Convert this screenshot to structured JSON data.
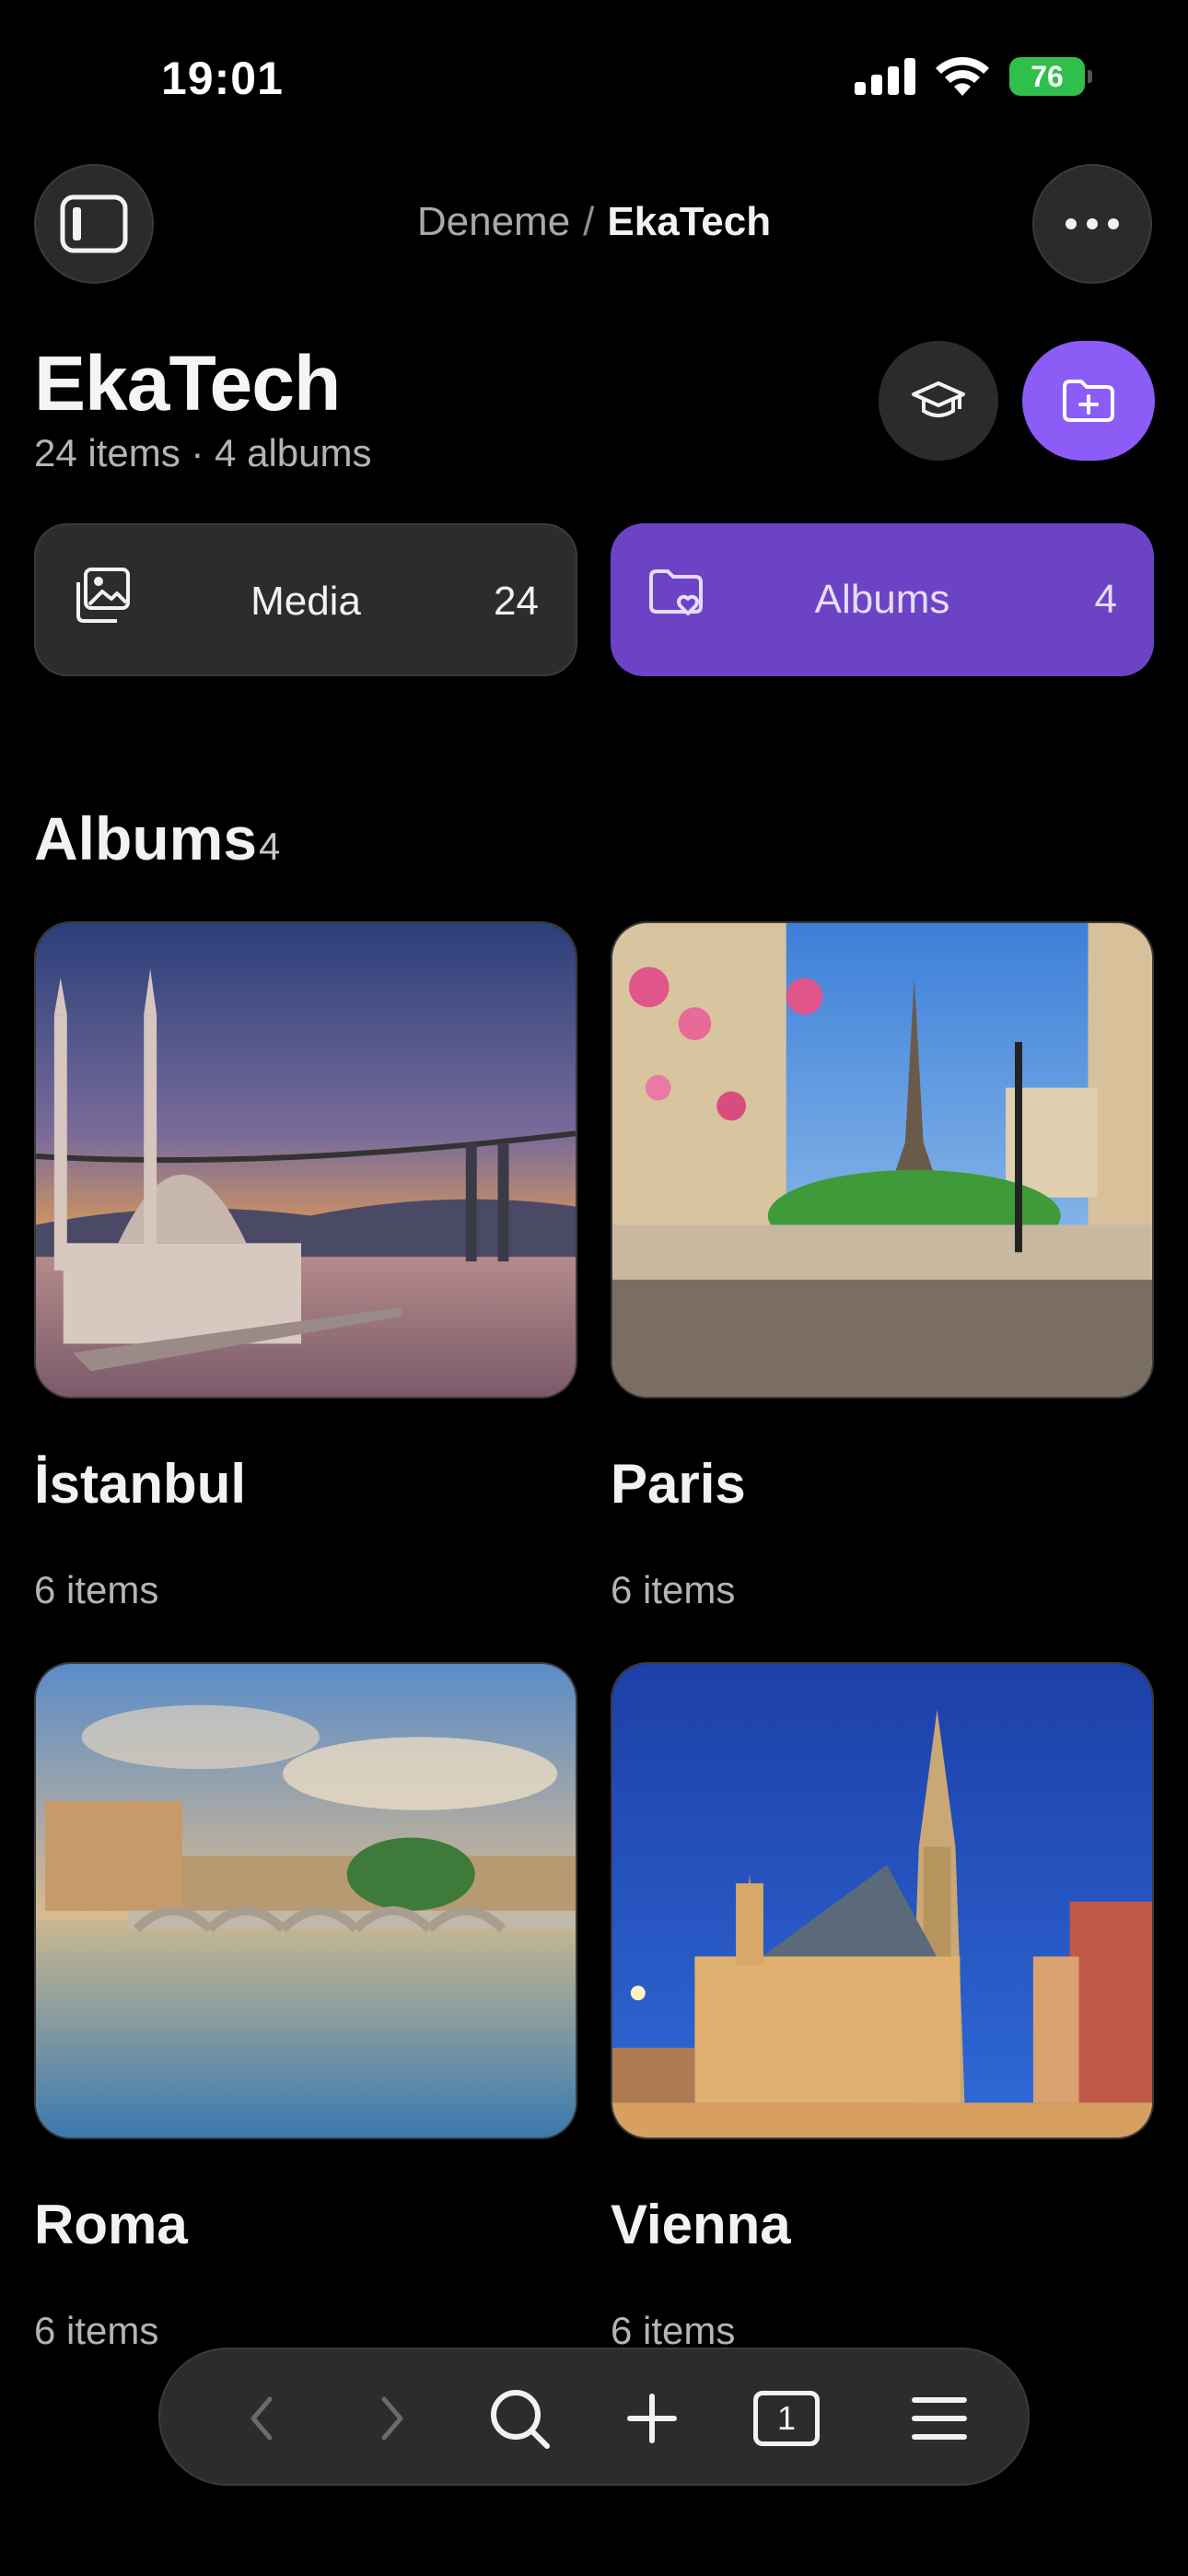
{
  "status": {
    "time": "19:01",
    "battery": "76"
  },
  "breadcrumb": {
    "parent": "Deneme",
    "separator": "/",
    "current": "EkaTech"
  },
  "header": {
    "title": "EkaTech",
    "subtitle": "24 items · 4 albums"
  },
  "segments": {
    "media": {
      "label": "Media",
      "count": "24"
    },
    "albums": {
      "label": "Albums",
      "count": "4"
    }
  },
  "albums_section": {
    "title": "Albums",
    "count": "4"
  },
  "albums": [
    {
      "name": "İstanbul",
      "count": "6 items"
    },
    {
      "name": "Paris",
      "count": "6 items"
    },
    {
      "name": "Roma",
      "count": "6 items"
    },
    {
      "name": "Vienna",
      "count": "6 items"
    }
  ],
  "toolbar": {
    "tab_count": "1"
  },
  "colors": {
    "accent": "#8b5cf6",
    "accent_dark": "#6d43c6",
    "surface": "#2c2c2e",
    "background": "#000000"
  },
  "icons": [
    "signal-icon",
    "wifi-icon",
    "battery-icon",
    "sidebar-icon",
    "more-icon",
    "mortarboard-icon",
    "folder-plus-icon",
    "photos-icon",
    "folder-heart-icon",
    "back-icon",
    "forward-icon",
    "search-icon",
    "plus-icon",
    "tabs-icon",
    "menu-icon"
  ]
}
